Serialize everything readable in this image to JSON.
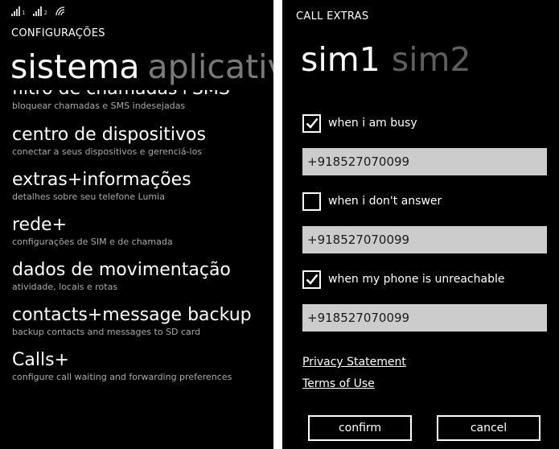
{
  "left": {
    "status": {
      "signal_1": "1",
      "signal_2": "2"
    },
    "app_title": "CONFIGURAÇÕES",
    "pivot": {
      "active": "sistema",
      "inactive": "aplicativ"
    },
    "items": [
      {
        "title": "filtro de chamadas+SMS",
        "subtitle": "bloquear chamadas e SMS indesejadas"
      },
      {
        "title": "centro de dispositivos",
        "subtitle": "conectar a seus dispositivos e gerenciá-los"
      },
      {
        "title": "extras+informações",
        "subtitle": "detalhes sobre seu telefone Lumia"
      },
      {
        "title": "rede+",
        "subtitle": "configurações de SIM e de chamada"
      },
      {
        "title": "dados de movimentação",
        "subtitle": "atividade, locais e rotas"
      },
      {
        "title": "contacts+message backup",
        "subtitle": "backup contacts and messages to SD card"
      },
      {
        "title": "Calls+",
        "subtitle": "configure call waiting and forwarding preferences"
      }
    ]
  },
  "right": {
    "title": "CALL EXTRAS",
    "tabs": {
      "active": "sim1",
      "inactive": "sim2"
    },
    "options": [
      {
        "label": "when i am busy",
        "checked": true,
        "number": "+918527070099"
      },
      {
        "label": "when i don't answer",
        "checked": false,
        "number": "+918527070099"
      },
      {
        "label": "when my phone is unreachable",
        "checked": true,
        "number": "+918527070099"
      }
    ],
    "links": {
      "privacy": "Privacy Statement",
      "terms": "Terms of Use"
    },
    "buttons": {
      "confirm": "confirm",
      "cancel": "cancel"
    }
  }
}
